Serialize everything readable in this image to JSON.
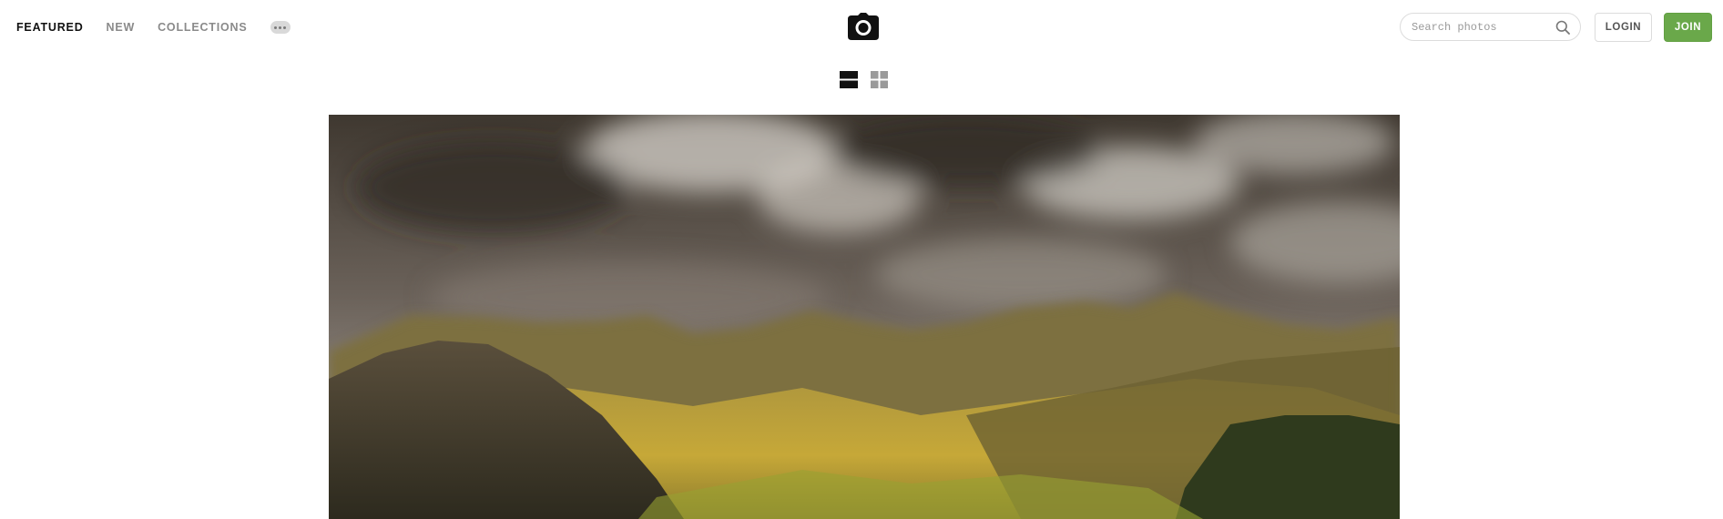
{
  "nav": {
    "items": [
      {
        "label": "FEATURED",
        "active": true
      },
      {
        "label": "NEW",
        "active": false
      },
      {
        "label": "COLLECTIONS",
        "active": false
      }
    ],
    "more_icon": "more-dots-icon"
  },
  "logo": {
    "icon": "camera-icon"
  },
  "search": {
    "placeholder": "Search photos",
    "value": "",
    "icon": "search-icon"
  },
  "auth": {
    "login_label": "LOGIN",
    "join_label": "JOIN"
  },
  "view_toggle": {
    "options": [
      {
        "icon": "list-view-icon",
        "active": true
      },
      {
        "icon": "grid-view-icon",
        "active": false
      }
    ]
  },
  "colors": {
    "accent": "#6aa84a",
    "text_active": "#111111",
    "text_muted": "#8a8a8a"
  }
}
